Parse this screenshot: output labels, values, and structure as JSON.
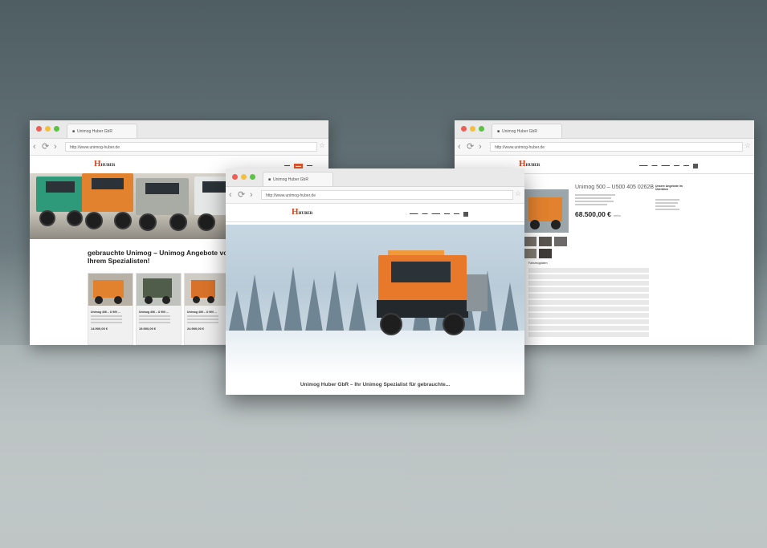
{
  "browsers": {
    "left": {
      "tab_title": "Unimog Huber GbR",
      "url": "http://www.unimog-huber.de",
      "logo": "HUBER",
      "heading": "gebrauchte Unimog – Unimog Angebote von Ihrem Spezialisten!",
      "cards": [
        {
          "title": "Unimog 406 – U 900 ...",
          "price": "14.900,00 €"
        },
        {
          "title": "Unimog 406 – U 900 ...",
          "price": "19.900,00 €"
        },
        {
          "title": "Unimog 406 – U 900 ...",
          "price": "24.900,00 €"
        }
      ]
    },
    "center": {
      "tab_title": "Unimog Huber GbR",
      "url": "http://www.unimog-huber.de",
      "logo": "HUBER",
      "caption": "Unimog Huber GbR – Ihr Unimog Spezialist für gebrauchte..."
    },
    "right": {
      "tab_title": "Unimog Huber GbR",
      "url": "http://www.unimog-huber.de",
      "logo": "HUBER",
      "product_title": "Unimog 500 – U500 405 0262B",
      "price": "68.500,00 €",
      "price_note": "netto",
      "side_box_title": "Unsere Angebote im Überblick",
      "table_tab": "Fahrzeugdaten"
    }
  },
  "icons": {
    "back": "‹",
    "refresh": "⟳",
    "forward": "›",
    "star": "☆"
  }
}
